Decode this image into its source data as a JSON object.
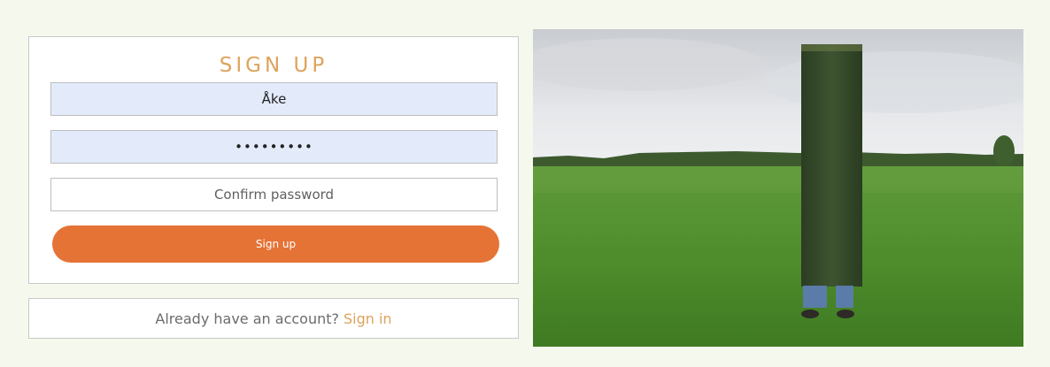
{
  "signup": {
    "title": "SIGN UP",
    "username_value": "Åke",
    "password_value": "•••••••••",
    "confirm_placeholder": "Confirm password",
    "submit_label": "Sign up"
  },
  "signin": {
    "prompt": "Already have an account?",
    "link_label": "Sign in"
  },
  "colors": {
    "background": "#f5f8ec",
    "accent_gold": "#dda35c",
    "button_orange": "#e57336",
    "autofill_blue": "#e3ebfb"
  },
  "photo": {
    "subject": "person holding tall grass turf block in field"
  }
}
